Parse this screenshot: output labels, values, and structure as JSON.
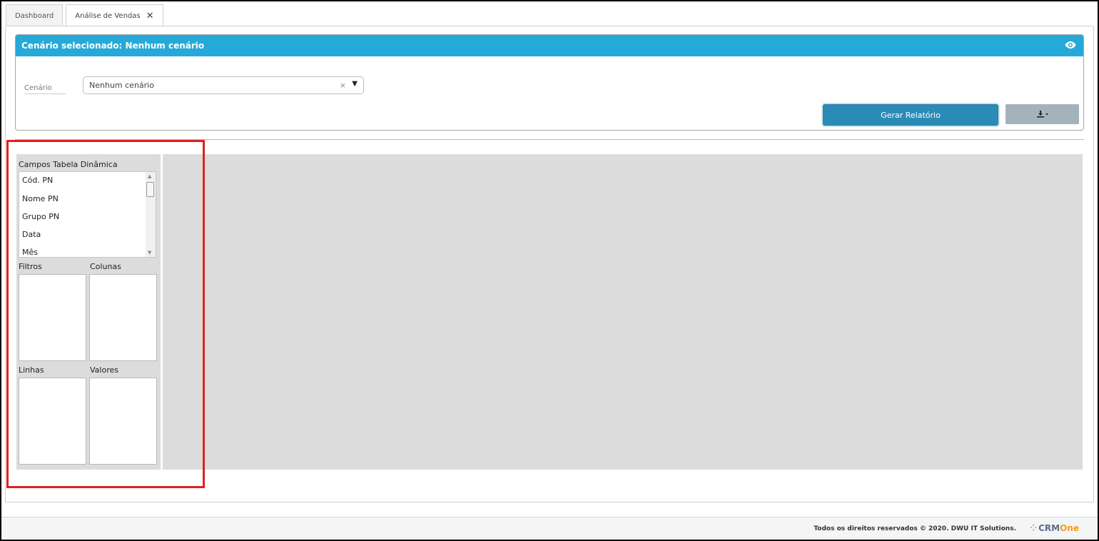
{
  "tabs": [
    {
      "label": "Dashboard"
    },
    {
      "label": "Análise de Vendas",
      "close": "✕"
    }
  ],
  "scenario": {
    "header_title": "Cenário selecionado: Nenhum cenário",
    "field_label": "Cenário",
    "select_value": "Nenhum cenário",
    "clear_glyph": "×",
    "caret_glyph": "▼",
    "generate_label": "Gerar Relatório",
    "download_glyph": "⬇▾"
  },
  "pivot": {
    "fields_title": "Campos Tabela Dinâmica",
    "fields": [
      "Cód. PN",
      "Nome PN",
      "Grupo PN",
      "Data",
      "Mês"
    ],
    "zones": {
      "filters": "Filtros",
      "columns": "Colunas",
      "rows": "Linhas",
      "values": "Valores"
    }
  },
  "footer": {
    "copyright": "Todos os direitos reservados © 2020.   DWU IT Solutions.",
    "logo_crm": "CRM",
    "logo_one": "One"
  },
  "colors": {
    "header_blue": "#25a9d9",
    "button_blue": "#2b8bb7",
    "button_gray": "#a4b2bb",
    "pivot_gray": "#dcdcdc",
    "highlight_red": "#e02020"
  },
  "icons": [
    "eye-icon",
    "close-icon",
    "clear-icon",
    "dropdown-caret-icon",
    "download-icon",
    "scroll-up-icon",
    "scroll-down-icon",
    "crmone-logo"
  ]
}
